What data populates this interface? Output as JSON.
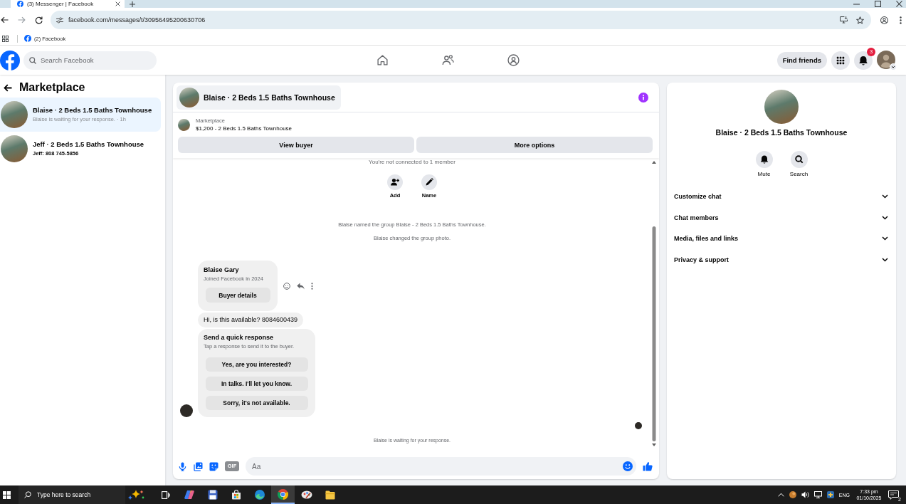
{
  "browser": {
    "tab_title": "(3) Messenger | Facebook",
    "url": "facebook.com/messages/t/30956495200630706",
    "bookmarks": [
      "(2) Facebook"
    ]
  },
  "topbar": {
    "search": {
      "placeholder": "Search Facebook"
    },
    "nav": [
      {
        "kind": "home"
      },
      {
        "kind": "friends"
      },
      {
        "kind": "groups"
      }
    ],
    "find_friends": "Find friends",
    "notification_badge": "3"
  },
  "sidebar": {
    "title": "Marketplace",
    "chats": [
      {
        "title": "Blaise · 2 Beds 1.5 Baths Townhouse",
        "preview": "Blaise is waiting for your response. · 1h",
        "selected": true,
        "unread": false
      },
      {
        "title": "Jeff · 2 Beds 1.5 Baths Townhouse",
        "preview": "Jeff: 808 745-5856",
        "selected": false,
        "unread": true
      }
    ]
  },
  "chat": {
    "title": "Blaise · 2 Beds 1.5 Baths Townhouse",
    "listing": {
      "source": "Marketplace",
      "summary": "$1,200 - 2 Beds 1.5 Baths Townhouse"
    },
    "buttons": [
      "View buyer",
      "More options"
    ],
    "notice": "You're not connected to 1 member",
    "member_actions": [
      {
        "kind": "add",
        "label": "Add"
      },
      {
        "kind": "rename",
        "label": "Name"
      }
    ],
    "events": [
      "Blaise named the group Blaise - 2 Beds 1.5 Baths Townhouse.",
      "Blaise changed the group photo."
    ],
    "messages": [
      {
        "kind": "profile",
        "name": "Blaise Gary",
        "detail": "Joined Facebook in 2024",
        "button": "Buyer details",
        "show_actions": true
      },
      {
        "kind": "text",
        "text": "Hi, is this available? 8084600439",
        "show_actions": false
      },
      {
        "kind": "quick_replies",
        "title": "Send a quick response",
        "hint": "Tap a response to send it to the buyer.",
        "options": [
          "Yes, are you interested?",
          "In talks. I'll let you know.",
          "Sorry, it's not available."
        ],
        "show_actions": false
      }
    ],
    "status": "Blaise is waiting for your response.",
    "composer": {
      "placeholder": "Aa",
      "gif_label": "GIF"
    }
  },
  "details": {
    "title": "Blaise · 2 Beds 1.5 Baths Townhouse",
    "actions": [
      {
        "kind": "mute",
        "label": "Mute"
      },
      {
        "kind": "search",
        "label": "Search"
      }
    ],
    "sections": [
      {
        "label": "Customize chat",
        "expanded": false
      },
      {
        "label": "Chat members",
        "expanded": false
      },
      {
        "label": "Media, files and links",
        "expanded": false
      },
      {
        "label": "Privacy & support",
        "expanded": false
      }
    ]
  },
  "taskbar": {
    "search": {
      "placeholder": "Type here to search"
    },
    "apps": [
      {
        "kind": "ribbon",
        "selected": false
      },
      {
        "kind": "floppy",
        "selected": false
      },
      {
        "kind": "bag",
        "selected": false
      },
      {
        "kind": "swirl",
        "selected": false
      },
      {
        "kind": "ring",
        "selected": true
      },
      {
        "kind": "palette",
        "selected": false
      },
      {
        "kind": "folder",
        "selected": false
      }
    ],
    "language": "ENG",
    "time": "7:33 pm",
    "date": "01/10/2025",
    "notification_count": "2"
  }
}
